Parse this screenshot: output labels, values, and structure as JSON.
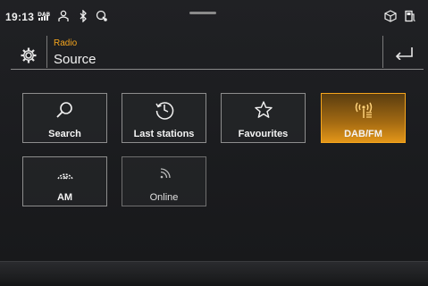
{
  "status": {
    "time": "19:13",
    "icons": [
      "dab-signal-icon",
      "user-icon",
      "bluetooth-icon",
      "phone-settings-icon",
      "package-icon",
      "fuel-icon"
    ]
  },
  "header": {
    "label": "Radio",
    "title": "Source",
    "settings_icon": "gear-icon",
    "back_icon": "back-arrow-icon"
  },
  "tiles": [
    {
      "label": "Search",
      "icon": "search-icon",
      "active": false
    },
    {
      "label": "Last stations",
      "icon": "clock-history-icon",
      "active": false
    },
    {
      "label": "Favourites",
      "icon": "star-icon",
      "active": false
    },
    {
      "label": "DAB/FM",
      "icon": "radio-tower-icon",
      "active": true
    },
    {
      "label": "AM",
      "icon": "am-signal-icon",
      "active": false
    },
    {
      "label": "Online",
      "icon": "online-signal-icon",
      "active": false
    }
  ],
  "colors": {
    "accent": "#f5a51d",
    "background": "#1d1e21",
    "text": "#f2f2f2"
  }
}
